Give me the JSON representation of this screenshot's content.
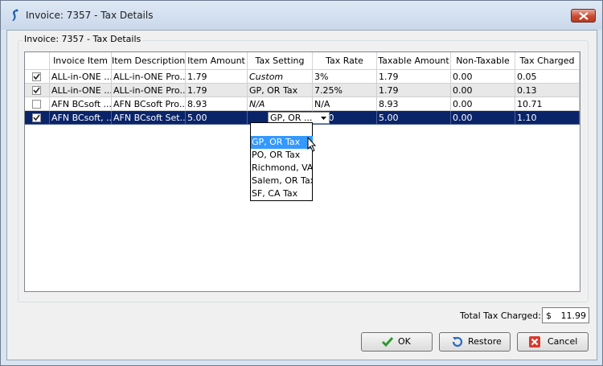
{
  "window": {
    "title": "Invoice: 7357 - Tax Details",
    "group_label": "Invoice: 7357 - Tax Details"
  },
  "columns": [
    "Invoice Item",
    "Item Description",
    "Item Amount",
    "Tax Setting",
    "Tax Rate",
    "Taxable Amount",
    "Non-Taxable",
    "Tax Charged"
  ],
  "rows": [
    {
      "checked": true,
      "invoice_item": "ALL-in-ONE ...",
      "description": "ALL-in-ONE Pro...",
      "amount": "1.79",
      "tax_setting": "Custom",
      "tax_rate": "3%",
      "taxable": "1.79",
      "non_taxable": "0.00",
      "tax_charged": "0.05"
    },
    {
      "checked": true,
      "invoice_item": "ALL-in-ONE ...",
      "description": "ALL-in-ONE Pro...",
      "amount": "1.79",
      "tax_setting": "GP, OR Tax",
      "tax_rate": "7.25%",
      "taxable": "1.79",
      "non_taxable": "0.00",
      "tax_charged": "0.13"
    },
    {
      "checked": false,
      "invoice_item": "AFN BCsoft ...",
      "description": "AFN BCsoft Pro...",
      "amount": "8.93",
      "tax_setting": "N/A",
      "tax_rate": "N/A",
      "taxable": "8.93",
      "non_taxable": "0.00",
      "tax_charged": "10.71"
    },
    {
      "checked": true,
      "invoice_item": "AFN BCsoft, ...",
      "description": "AFN BCsoft Set...",
      "amount": "5.00",
      "tax_setting": "GP, OR ...",
      "tax_rate": "1.10",
      "taxable": "5.00",
      "non_taxable": "0.00",
      "tax_charged": "1.10"
    }
  ],
  "dropdown": {
    "options": [
      "GP, OR Tax",
      "PO, OR Tax",
      "Richmond, VA Tax",
      "Salem, OR Tax",
      "SF, CA Tax"
    ],
    "selected": "GP, OR Tax"
  },
  "total": {
    "label": "Total Tax Charged:",
    "currency": "$",
    "value": "11.99"
  },
  "buttons": {
    "ok": "OK",
    "restore": "Restore",
    "cancel": "Cancel"
  },
  "colors": {
    "selection": "#0a246a",
    "dropdown_highlight": "#3399ff"
  }
}
